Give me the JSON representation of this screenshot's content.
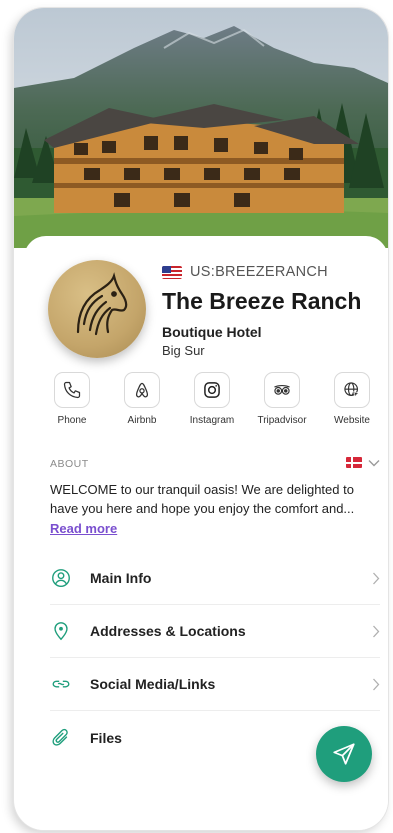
{
  "profile": {
    "reference": "US:BREEZERANCH",
    "name": "The Breeze Ranch",
    "category": "Boutique Hotel",
    "city": "Big Sur"
  },
  "links": [
    {
      "label": "Phone",
      "icon": "phone-icon"
    },
    {
      "label": "Airbnb",
      "icon": "airbnb-icon"
    },
    {
      "label": "Instagram",
      "icon": "instagram-icon"
    },
    {
      "label": "Tripadvisor",
      "icon": "tripadvisor-icon"
    },
    {
      "label": "Website",
      "icon": "globe-icon"
    }
  ],
  "about": {
    "label": "ABOUT",
    "text": "WELCOME to our tranquil oasis! We are delighted to have you here and hope you enjoy the comfort and...",
    "read_more": "Read more"
  },
  "menu": [
    {
      "label": "Main Info",
      "icon": "user-circle-icon"
    },
    {
      "label": "Addresses & Locations",
      "icon": "location-pin-icon"
    },
    {
      "label": "Social Media/Links",
      "icon": "link-icon"
    },
    {
      "label": "Files",
      "icon": "paperclip-icon"
    }
  ],
  "colors": {
    "accent": "#1f9e7c",
    "link": "#7a4fcf"
  }
}
